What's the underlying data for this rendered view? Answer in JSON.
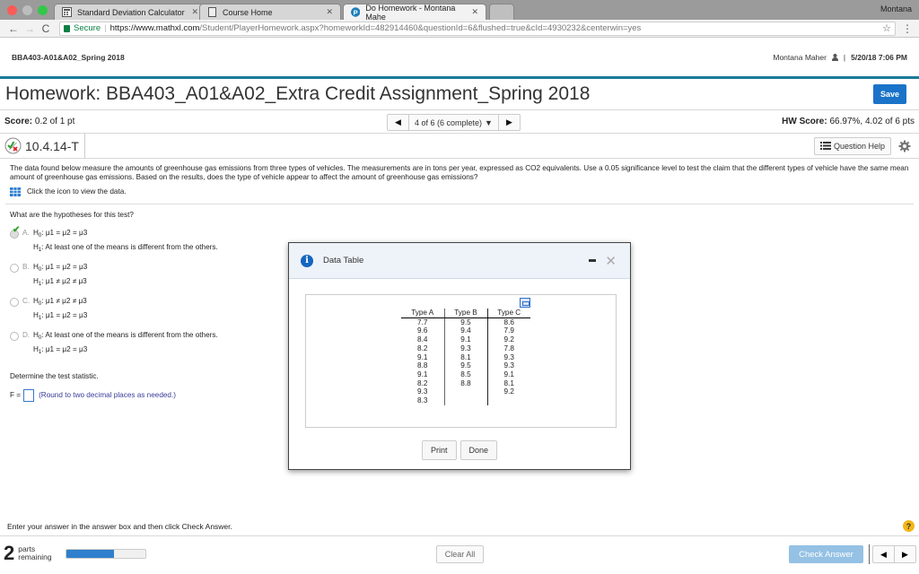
{
  "browser": {
    "tabs": [
      {
        "label": "Standard Deviation Calculator",
        "icon": "calculator-icon",
        "active": false
      },
      {
        "label": "Course Home",
        "icon": "page-icon",
        "active": false
      },
      {
        "label": "Do Homework - Montana Mahe",
        "icon": "pearson-icon",
        "active": true
      }
    ],
    "profile_name": "Montana",
    "secure_label": "Secure",
    "url_host": "https://www.mathxl.com",
    "url_rest": "/Student/PlayerHomework.aspx?homeworkId=482914460&questionId=6&flushed=true&cId=4930232&centerwin=yes"
  },
  "course": {
    "name": "BBA403-A01&A02_Spring 2018",
    "user": "Montana Maher",
    "separator": "|",
    "datetime": "5/20/18 7:06 PM"
  },
  "homework": {
    "title": "Homework: BBA403_A01&A02_Extra Credit Assignment_Spring 2018",
    "save_label": "Save"
  },
  "score": {
    "label": "Score:",
    "value": "0.2 of 1 pt",
    "question_position": "4 of 6 (6 complete)",
    "hw_label": "HW Score:",
    "hw_value": "66.97%, 4.02 of 6 pts"
  },
  "question": {
    "id": "10.4.14-T",
    "help_label": "Question Help",
    "prompt": "The data found below measure the amounts of greenhouse gas emissions from three types of vehicles. The measurements are in tons per year, expressed as CO2 equivalents. Use a 0.05 significance level to test the claim that the different types of vehicle have the same mean amount of greenhouse gas emissions. Based on the results, does the type of vehicle appear to affect the amount of greenhouse gas emissions?",
    "view_data_text": "Click the icon to view the data.",
    "hypotheses_question": "What are the hypotheses for this test?",
    "choices": [
      {
        "letter": "A.",
        "h0": "μ1 = μ2 = μ3",
        "h1": "At least one of the means is different from the others.",
        "selected": true
      },
      {
        "letter": "B.",
        "h0": "μ1 = μ2 = μ3",
        "h1": "μ1 ≠ μ2 ≠ μ3",
        "selected": false
      },
      {
        "letter": "C.",
        "h0": "μ1 ≠ μ2 ≠ μ3",
        "h1": "μ1 = μ2 = μ3",
        "selected": false
      },
      {
        "letter": "D.",
        "h0": "At least one of the means is different from the others.",
        "h1": "μ1 = μ2 = μ3",
        "selected": false
      }
    ],
    "h0_label": "H0:",
    "h1_label": "H1:",
    "test_stat_prompt": "Determine the test statistic.",
    "f_label": "F =",
    "f_value": "",
    "round_hint": "(Round to two decimal places as needed.)"
  },
  "dialog": {
    "title": "Data Table",
    "columns": [
      "Type A",
      "Type B",
      "Type C"
    ],
    "rows": [
      [
        "7.7",
        "9.5",
        "8.6"
      ],
      [
        "9.6",
        "9.4",
        "7.9"
      ],
      [
        "8.4",
        "9.1",
        "9.2"
      ],
      [
        "8.2",
        "9.3",
        "7.8"
      ],
      [
        "9.1",
        "8.1",
        "9.3"
      ],
      [
        "8.8",
        "9.5",
        "9.3"
      ],
      [
        "9.1",
        "8.5",
        "9.1"
      ],
      [
        "8.2",
        "8.8",
        "8.1"
      ],
      [
        "9.3",
        "",
        "9.2"
      ],
      [
        "8.3",
        "",
        ""
      ]
    ],
    "print_label": "Print",
    "done_label": "Done"
  },
  "footer": {
    "instruction": "Enter your answer in the answer box and then click Check Answer.",
    "parts_count": "2",
    "parts_label_1": "parts",
    "parts_label_2": "remaining",
    "progress_fraction": 0.6,
    "clear_label": "Clear All",
    "check_label": "Check Answer"
  }
}
